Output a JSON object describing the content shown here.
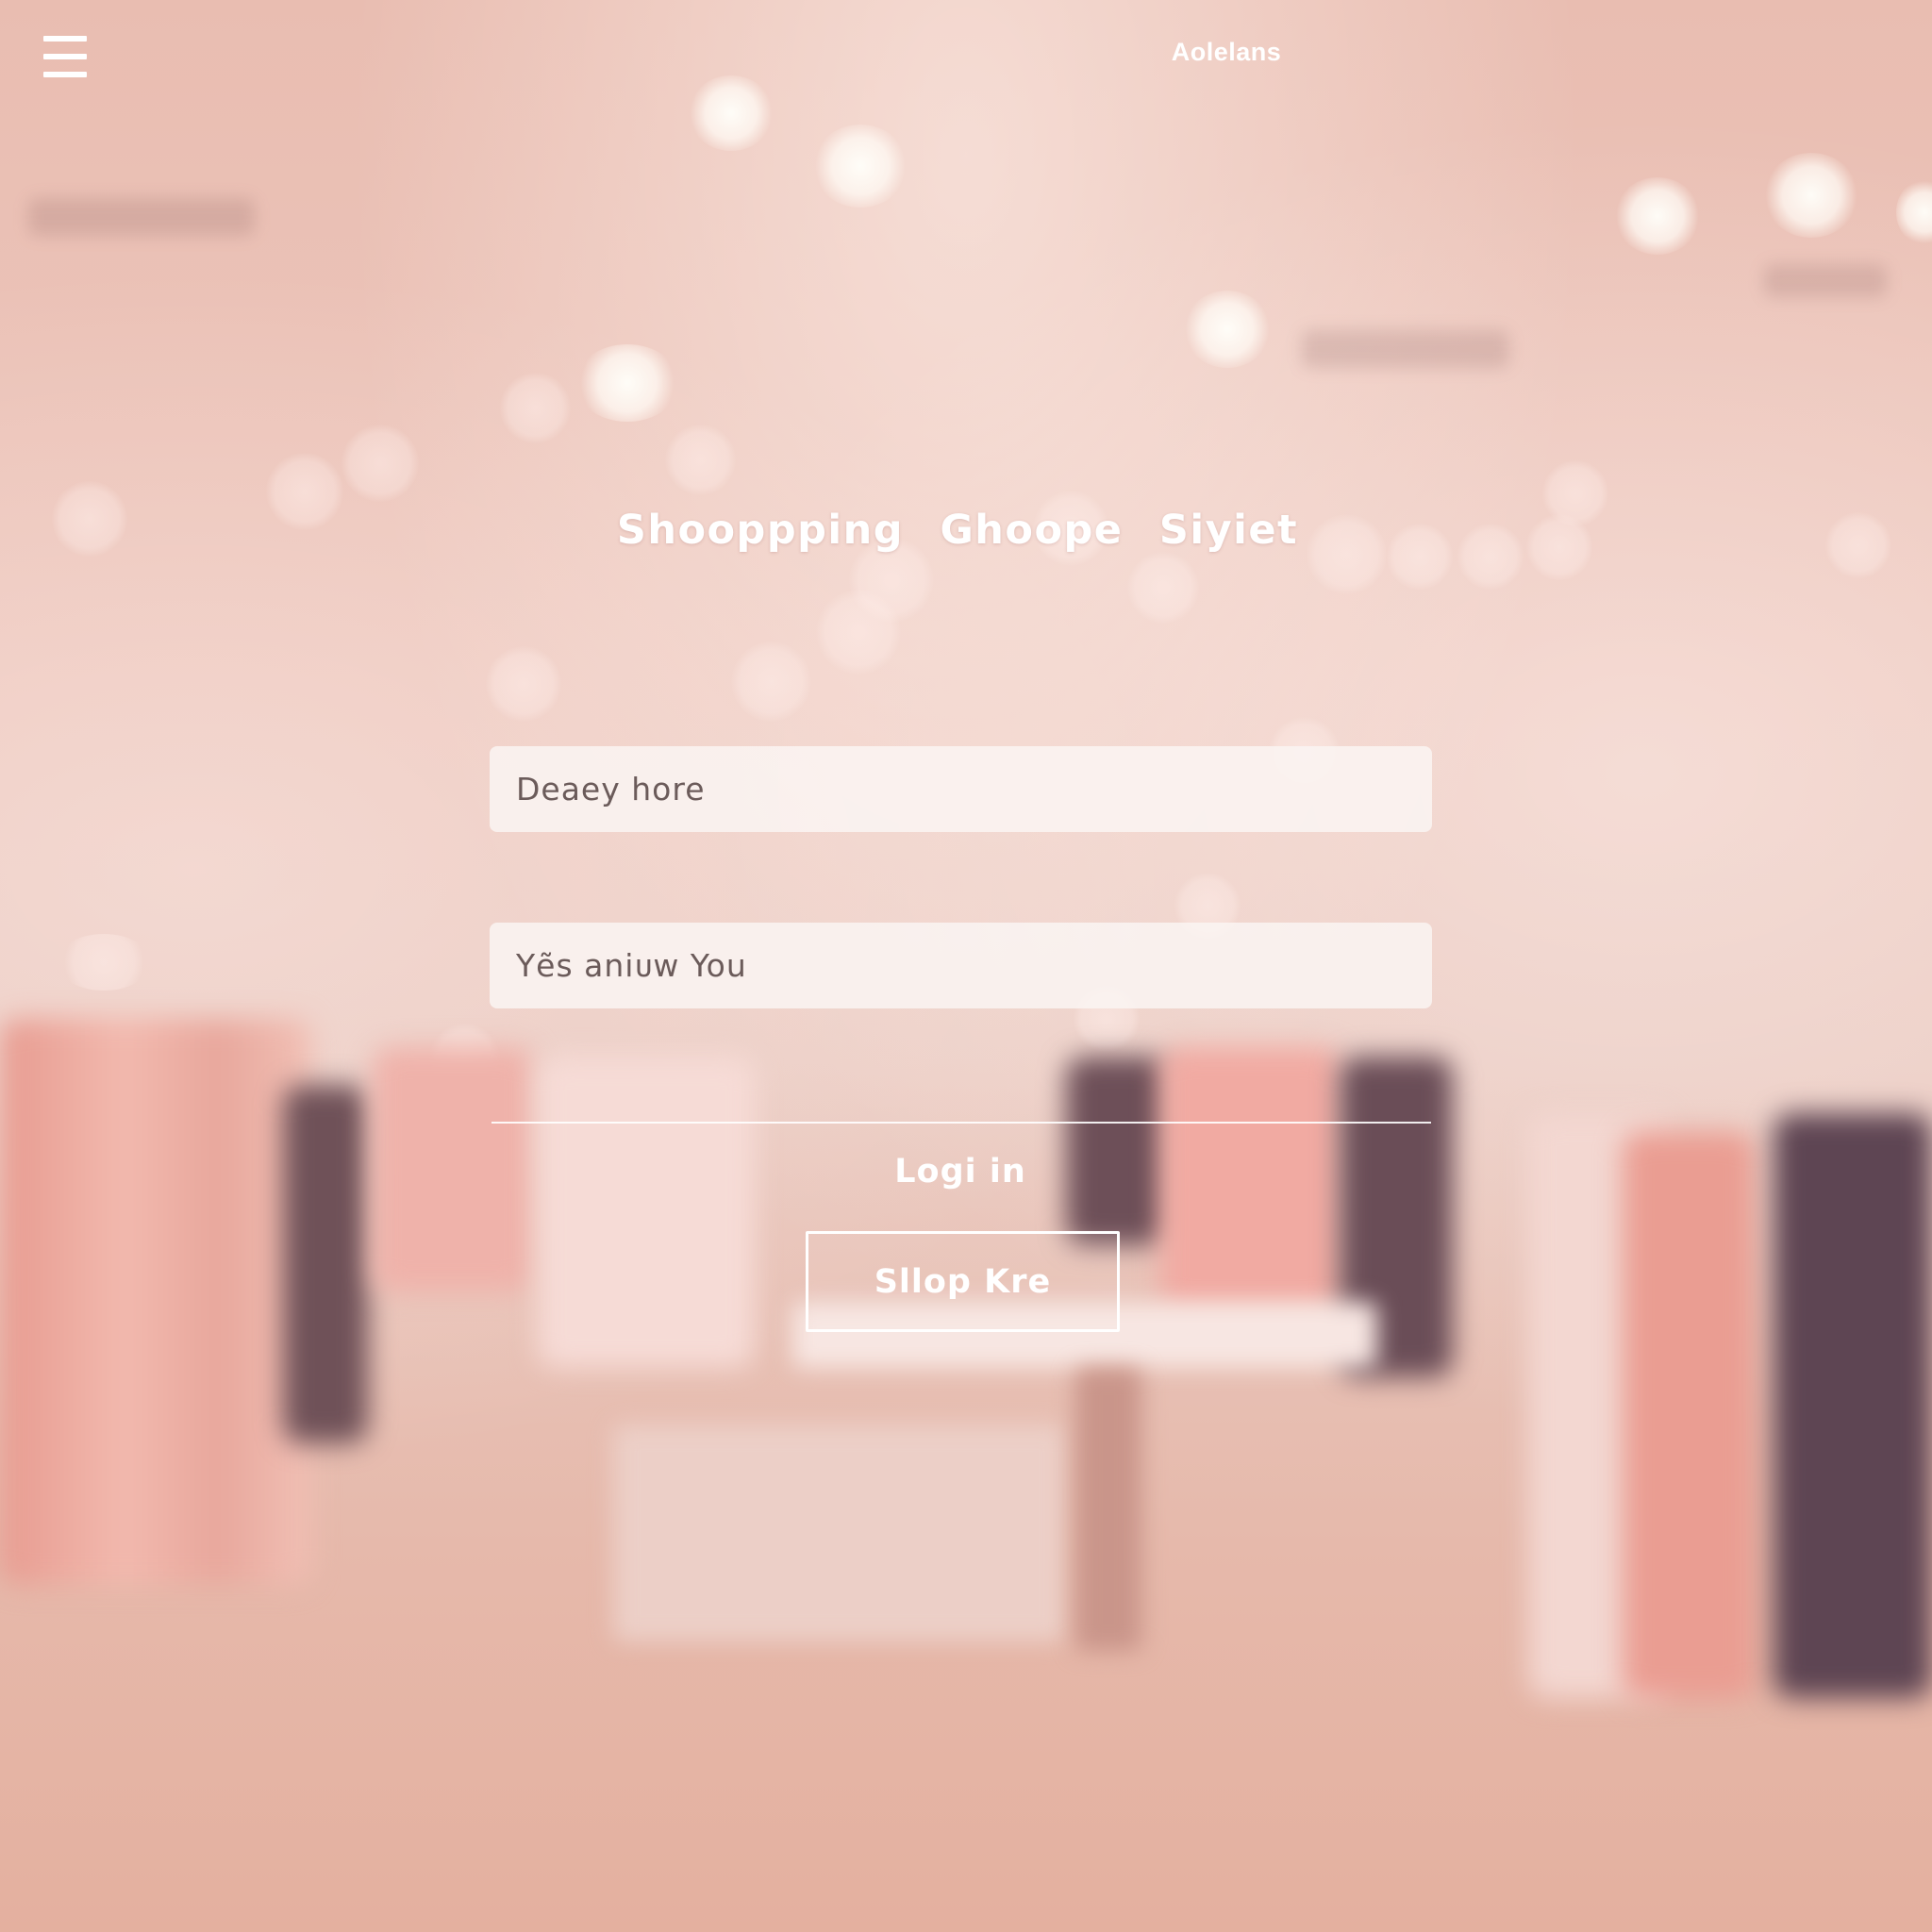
{
  "header": {
    "menu_icon": "hamburger-menu-icon",
    "brand": "Aolelans"
  },
  "hero": {
    "title": "Shooppping   Ghoope Siyiet"
  },
  "form": {
    "field_1": {
      "value": "Deaey hore"
    },
    "field_2": {
      "value": "Yẽs aniᴜw You"
    },
    "login_label": "Logi in",
    "shop_button_label": "Sllop Kre"
  },
  "colors": {
    "background_tint": "#e6b8ac",
    "text_light": "#ffffff",
    "field_bg": "#faf4f2",
    "field_text": "#6b5b5a"
  }
}
